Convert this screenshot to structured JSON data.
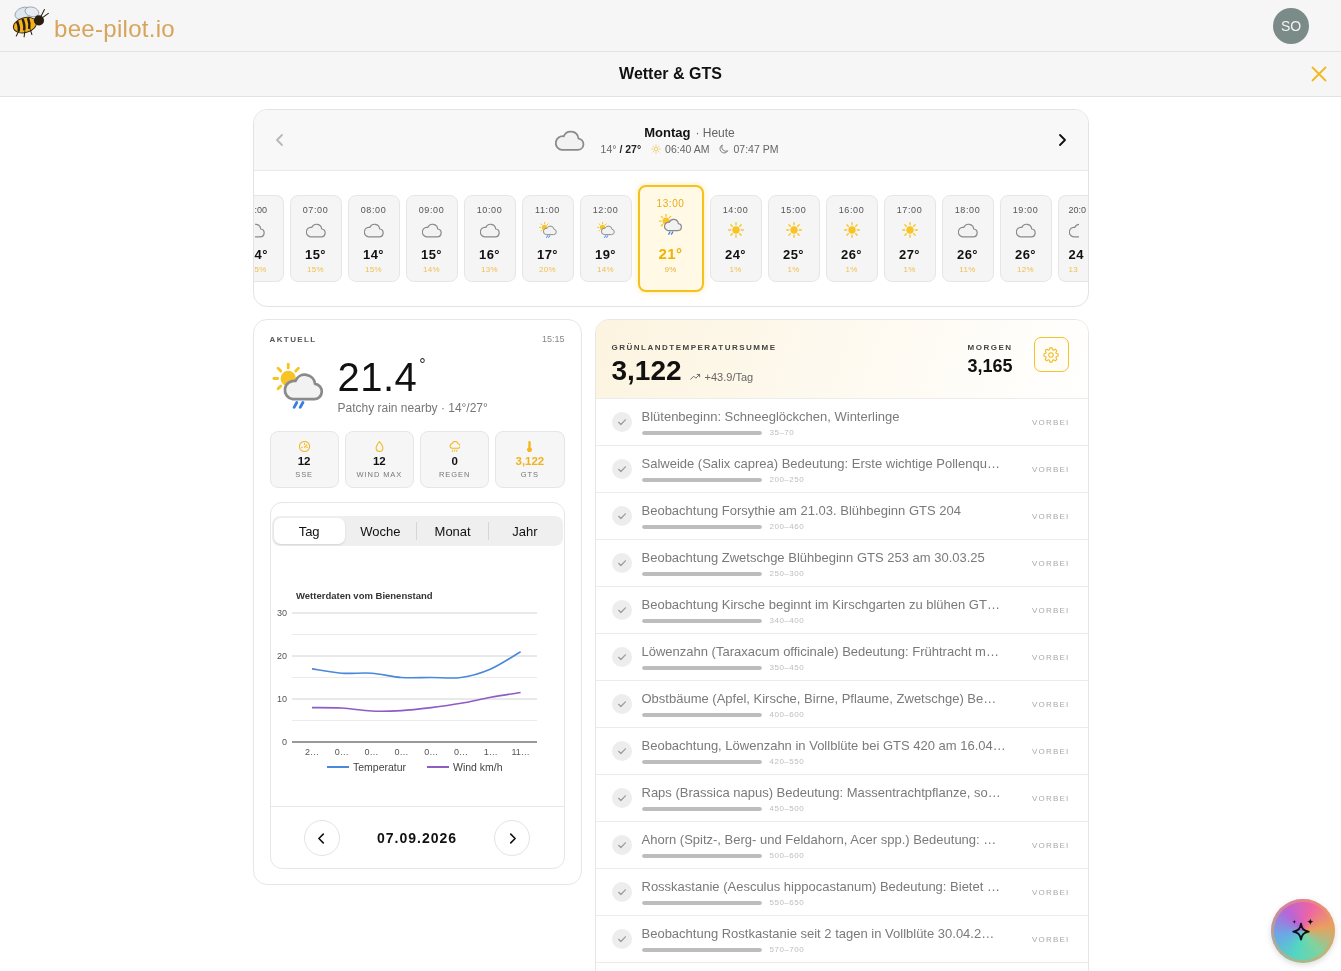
{
  "header": {
    "logo_text": "bee-pilot.io",
    "avatar_initials": "SO"
  },
  "title_bar": {
    "title": "Wetter & GTS"
  },
  "day": {
    "kind": "cloud",
    "name": "Montag",
    "relative": "· Heute",
    "temp_range": "14° **/ 27°**",
    "sunrise": "06:40 AM",
    "sunset": "07:47 PM",
    "prev_disabled": true,
    "next_disabled": false
  },
  "hourly": [
    {
      "kind": "cloud",
      "time": ":00",
      "temp": "4°",
      "rain": "5%",
      "selected": false
    },
    {
      "kind": "cloud",
      "time": "07:00",
      "temp": "15°",
      "rain": "15%",
      "selected": false
    },
    {
      "kind": "cloud",
      "time": "08:00",
      "temp": "14°",
      "rain": "15%",
      "selected": false
    },
    {
      "kind": "cloud",
      "time": "09:00",
      "temp": "15°",
      "rain": "14%",
      "selected": false
    },
    {
      "kind": "cloud",
      "time": "10:00",
      "temp": "16°",
      "rain": "13%",
      "selected": false
    },
    {
      "kind": "sun_cloud_rain",
      "time": "11:00",
      "temp": "17°",
      "rain": "20%",
      "selected": false
    },
    {
      "kind": "sun_cloud_rain",
      "time": "12:00",
      "temp": "19°",
      "rain": "14%",
      "selected": false
    },
    {
      "kind": "sun_cloud_rain",
      "time": "13:00",
      "temp": "21°",
      "rain": "9%",
      "selected": true
    },
    {
      "kind": "sun",
      "time": "14:00",
      "temp": "24°",
      "rain": "1%",
      "selected": false
    },
    {
      "kind": "sun",
      "time": "15:00",
      "temp": "25°",
      "rain": "1%",
      "selected": false
    },
    {
      "kind": "sun",
      "time": "16:00",
      "temp": "26°",
      "rain": "1%",
      "selected": false
    },
    {
      "kind": "sun",
      "time": "17:00",
      "temp": "27°",
      "rain": "1%",
      "selected": false
    },
    {
      "kind": "cloud",
      "time": "18:00",
      "temp": "26°",
      "rain": "11%",
      "selected": false
    },
    {
      "kind": "cloud",
      "time": "19:00",
      "temp": "26°",
      "rain": "12%",
      "selected": false
    },
    {
      "kind": "cloud",
      "time": "20:0",
      "temp": "24",
      "rain": "13",
      "selected": false
    }
  ],
  "current": {
    "label": "AKTUELL",
    "time": "15:15",
    "kind": "sun_cloud_rain",
    "temperature": "21.4",
    "unit": "°",
    "summary": "Patchy rain nearby · 14°/27°",
    "stats": [
      {
        "kind": "gauge",
        "value": "12",
        "label": "SSE",
        "highlight": false
      },
      {
        "kind": "drop",
        "value": "12",
        "label": "WIND MAX",
        "highlight": false
      },
      {
        "kind": "cloud_rain",
        "value": "0",
        "label": "REGEN",
        "highlight": false
      },
      {
        "kind": "thermometer",
        "value": "3,122",
        "label": "GTS",
        "highlight": true
      }
    ]
  },
  "chart_panel": {
    "tabs": [
      {
        "label": "Tag",
        "selected": true
      },
      {
        "label": "Woche",
        "selected": false
      },
      {
        "label": "Monat",
        "selected": false
      },
      {
        "label": "Jahr",
        "selected": false
      }
    ],
    "chart_data": {
      "type": "line",
      "title": "Wetterdaten vom Bienenstand",
      "categories": [
        "2…",
        "0…",
        "0…",
        "0…",
        "0…",
        "0…",
        "1…",
        "11…"
      ],
      "series": [
        {
          "name": "Temperatur",
          "color": "#4a88da",
          "values": [
            17,
            16,
            16,
            15,
            15,
            15,
            17,
            21
          ]
        },
        {
          "name": "Wind km/h",
          "color": "#8e5cc4",
          "values": [
            8,
            7.9,
            7.2,
            7.3,
            8,
            9,
            10.4,
            11.5
          ]
        }
      ],
      "ylim": [
        0,
        30
      ],
      "yticks": [
        0,
        10,
        20,
        30
      ],
      "legend": "bottom"
    },
    "date": "07.09.2026"
  },
  "gts": {
    "label": "GRÜNLANDTEMPERATURSUMME",
    "value": "3,122",
    "trend": "+43.9/Tag",
    "tomorrow_label": "MORGEN",
    "tomorrow_value": "3,165",
    "milestones": [
      {
        "title": "Blütenbeginn: Schneeglöckchen, Winterlinge",
        "range": "35–70",
        "status": "VORBEI",
        "done": true,
        "level": 1
      },
      {
        "title": "Salweide (Salix caprea) Bedeutung: Erste wichtige Pollenqu…",
        "range": "200–250",
        "status": "VORBEI",
        "done": true,
        "level": 1
      },
      {
        "title": "Beobachtung Forsythie am 21.03. Blühbeginn GTS 204",
        "range": "200–460",
        "status": "VORBEI",
        "done": true,
        "level": 1
      },
      {
        "title": "Beobachtung Zwetschge Blühbeginn GTS 253 am 30.03.25",
        "range": "250–300",
        "status": "VORBEI",
        "done": true,
        "level": 1
      },
      {
        "title": "Beobachtung Kirsche beginnt im Kirschgarten zu blühen GT…",
        "range": "340–400",
        "status": "VORBEI",
        "done": true,
        "level": 1
      },
      {
        "title": "Löwenzahn (Taraxacum officinale) Bedeutung: Frühtracht m…",
        "range": "350–450",
        "status": "VORBEI",
        "done": true,
        "level": 1
      },
      {
        "title": "Obstbäume (Apfel, Kirsche, Birne, Pflaume, Zwetschge) Be…",
        "range": "400–600",
        "status": "VORBEI",
        "done": true,
        "level": 1
      },
      {
        "title": "Beobachtung, Löwenzahn in Vollblüte bei GTS 420 am 16.04…",
        "range": "420–550",
        "status": "VORBEI",
        "done": true,
        "level": 1
      },
      {
        "title": "Raps (Brassica napus) Bedeutung: Massentrachtpflanze, so…",
        "range": "450–500",
        "status": "VORBEI",
        "done": true,
        "level": 1
      },
      {
        "title": "Ahorn (Spitz-, Berg- und Feldahorn, Acer spp.) Bedeutung: …",
        "range": "500–600",
        "status": "VORBEI",
        "done": true,
        "level": 1
      },
      {
        "title": "Rosskastanie (Aesculus hippocastanum) Bedeutung: Bietet …",
        "range": "550–650",
        "status": "VORBEI",
        "done": true,
        "level": 1
      },
      {
        "title": "Beobachtung Rostkastanie seit 2 tagen in Vollblüte 30.04.2…",
        "range": "570–700",
        "status": "VORBEI",
        "done": true,
        "level": 1
      }
    ]
  }
}
